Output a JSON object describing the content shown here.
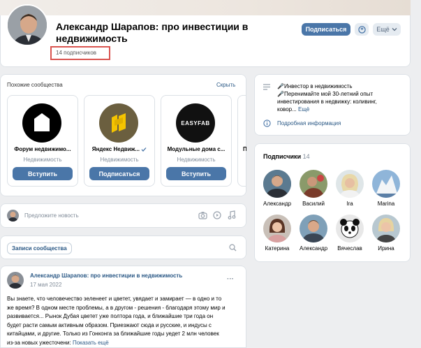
{
  "header": {
    "title": "Александр Шарапов: про инвестиции в недвижимость",
    "subscribers": "14 подписчиков",
    "subscribe_label": "Подписаться",
    "more_label": "Ещё"
  },
  "similar": {
    "title": "Похожие сообщества",
    "hide_label": "Скрыть",
    "items": [
      {
        "name": "Форум недвижимо...",
        "category": "Недвижимость",
        "button": "Вступить"
      },
      {
        "name": "Яндекс Недвиж...",
        "category": "Недвижимость",
        "button": "Подписаться"
      },
      {
        "name": "Модульные дома с...",
        "category": "Недвижимость",
        "button": "Вступить",
        "logo_text": "EASYFAB"
      },
      {
        "name": "П",
        "category": "",
        "button": ""
      }
    ]
  },
  "about": {
    "line1": "🎤Инвестор в недвижимость",
    "line2": "🎤Перенимайте мой 30-летний опыт",
    "line3": "инвестирования в недвижку: коливинг,",
    "line4_prefix": "ковор...",
    "more_label": "Ещё",
    "details_label": "Подробная информация"
  },
  "followers": {
    "title": "Подписчики",
    "count": "14",
    "people": [
      {
        "name": "Александр"
      },
      {
        "name": "Василий"
      },
      {
        "name": "Ira"
      },
      {
        "name": "Marina"
      },
      {
        "name": "Катерина"
      },
      {
        "name": "Александр"
      },
      {
        "name": "Вячеслав"
      },
      {
        "name": "Ирина"
      }
    ]
  },
  "composer": {
    "placeholder": "Предложите новость"
  },
  "wall": {
    "tab_label": "Записи сообщества"
  },
  "post": {
    "author": "Александр Шарапов: про инвестиции в недвижимость",
    "date": "17 мая 2022",
    "more_icon": "···",
    "lines": [
      "Вы знаете, что человечество зеленеет и цветет, увядает и замирает — в одно и то",
      "же время? В одном месте проблемы, а в другом - решения - благодаря этому мир и",
      "развивается... Рынок Дубая цветет уже полтора года, и ближайшие три года он",
      "будет расти самым активным образом. Приезжают сюда и русские, и индусы с",
      "китайцами, и другие. Только из Гонконга за ближайшие годы уедет 2 млн человек",
      "из-за новых ужесточени"
    ],
    "show_more": "Показать ещё"
  },
  "colors": {
    "accent": "#4a76a8",
    "highlight_box": "#d9534f"
  }
}
